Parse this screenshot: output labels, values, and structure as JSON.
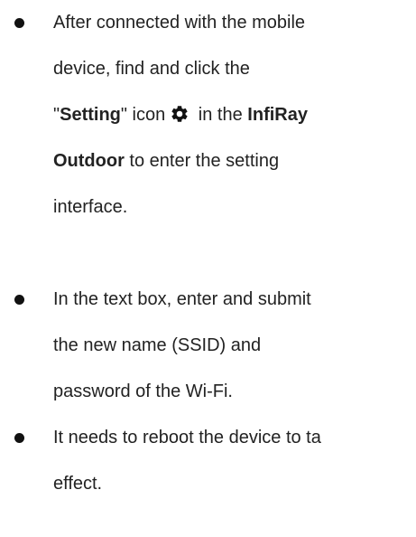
{
  "instructions": {
    "step1": {
      "line1": "After connected with the mobile",
      "line2": "device, find and click the",
      "line3_pre": "\"",
      "setting_label": "Setting",
      "line3_mid": "\" icon",
      "gear_icon": "gear-icon",
      "line3_post": " in the ",
      "app_name_part1": "InfiRay",
      "app_name_part2": "Outdoor",
      "line4_post": " to enter the setting",
      "line5": "interface."
    },
    "step2": {
      "line1": "In the text box, enter and submit",
      "line2": "the new name (SSID) and",
      "line3": "password of the Wi-Fi."
    },
    "step3": {
      "line1": "It needs to reboot the device to ta",
      "line2": "effect."
    }
  }
}
